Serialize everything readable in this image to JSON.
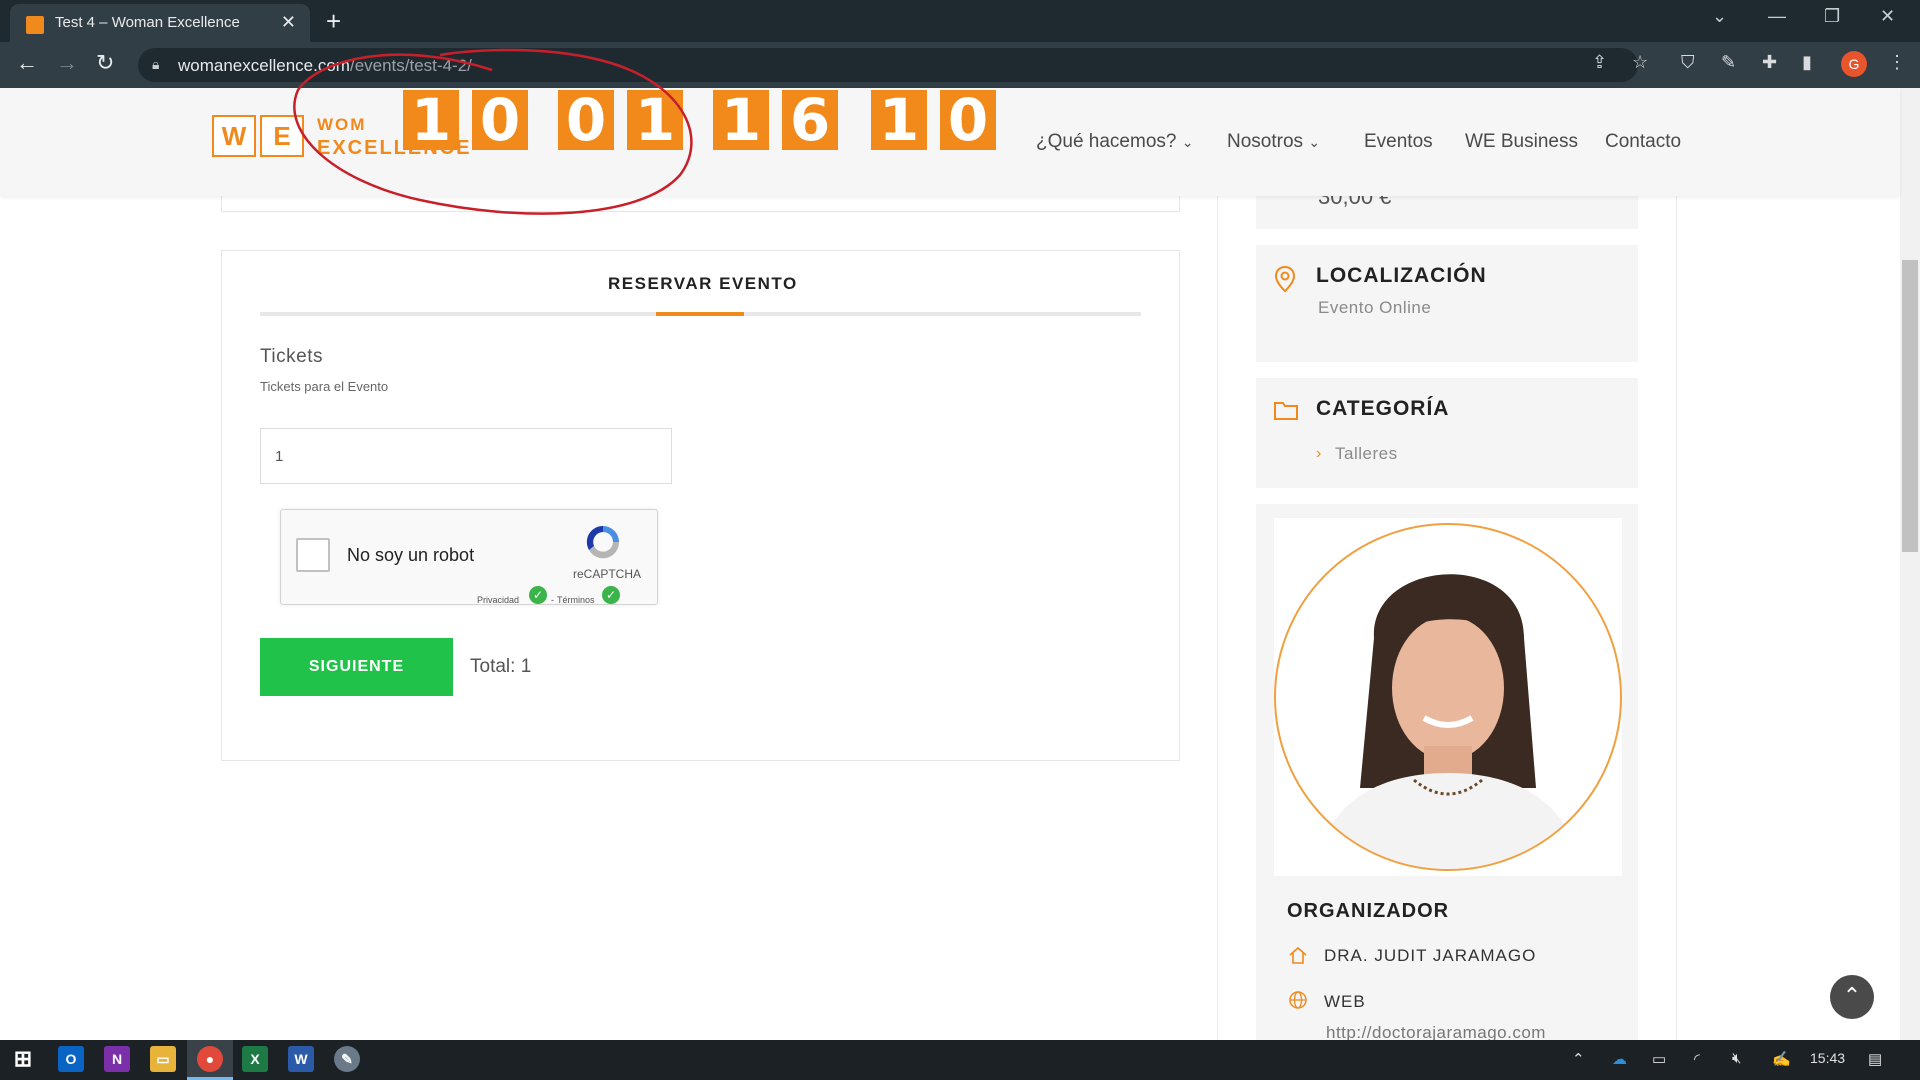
{
  "browser": {
    "tab_title": "Test 4 – Woman Excellence",
    "tab_close": "✕",
    "new_tab": "+",
    "url_domain": "womanexcellence.com",
    "url_path": "/events/test-4-2/",
    "profile_initial": "G"
  },
  "site": {
    "logo_w": "W",
    "logo_e": "E",
    "logo_line1": "WOM",
    "logo_line2": "EXCELLENCE",
    "countdown": [
      "1",
      "0",
      "0",
      "1",
      "1",
      "6",
      "1",
      "0"
    ],
    "menu": [
      "¿Qué hacemos?",
      "Nosotros",
      "Eventos",
      "WE Business",
      "Contacto"
    ],
    "menu_has_dropdown": [
      true,
      true,
      false,
      false,
      false
    ]
  },
  "booking": {
    "tab_label": "RESERVAR EVENTO",
    "tickets_label": "Tickets",
    "tickets_help": "Tickets para el Evento",
    "quantity": "1",
    "captcha_label": "No soy un robot",
    "captcha_brand": "reCAPTCHA",
    "captcha_privacy": "Privacidad",
    "captcha_sep": "-",
    "captcha_terms": "Términos",
    "next_button": "SIGUIENTE",
    "total": "Total: 1"
  },
  "sidebar": {
    "price": "30,00 €",
    "location_title": "LOCALIZACIÓN",
    "location_value": "Evento Online",
    "category_title": "CATEGORÍA",
    "category_value": "Talleres",
    "organizer_title": "ORGANIZADOR",
    "organizer_name": "DRA. JUDIT JARAMAGO",
    "web_label": "WEB",
    "web_url": "http://doctorajaramago.com"
  },
  "taskbar": {
    "time": "15:43"
  },
  "colors": {
    "accent": "#f08a1c",
    "button_green": "#20c24a",
    "annotation_red": "#c8202a"
  }
}
